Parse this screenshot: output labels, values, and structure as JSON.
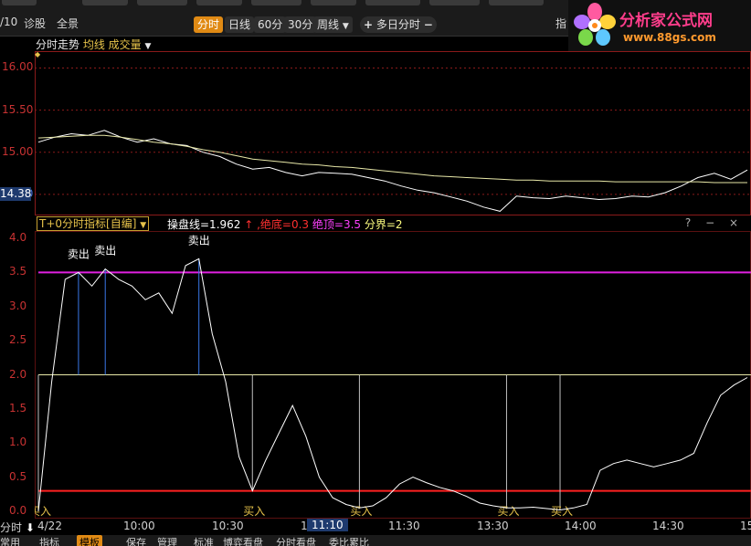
{
  "toolbar": {
    "date_fragment": "/10",
    "tab_diagnosis": "诊股",
    "tab_panorama": "全景",
    "periods": [
      "分时",
      "日线",
      "60分",
      "30分",
      "周线"
    ],
    "period_active": "分时",
    "multi_day": "多日分时",
    "indicator_btn": "指"
  },
  "logo": {
    "title": "分析家公式网",
    "url": "www.88gs.com"
  },
  "subtitle": {
    "label": "分时走势",
    "options": "均线 成交量"
  },
  "price_panel": {
    "yticks": [
      "16.00",
      "15.50",
      "15.00",
      "14.50"
    ],
    "current_price": "14.38",
    "colors": {
      "price_line": "#ffffff",
      "avg_line": "#e8e8a8",
      "grid": "#8a1a1a"
    }
  },
  "indicator": {
    "name": "T+0分时指标[自编]",
    "params": [
      {
        "text": "操盘线=1.962",
        "color": "#ffffff"
      },
      {
        "text": "↑",
        "color": "#ff3030"
      },
      {
        "text": ",绝底=0.3",
        "color": "#ff3030"
      },
      {
        "text": "绝顶=3.5",
        "color": "#ff40ff"
      },
      {
        "text": "分界=2",
        "color": "#ffff80"
      }
    ],
    "controls": "? − ×",
    "yticks": [
      "4.0",
      "3.5",
      "3.0",
      "2.5",
      "2.0",
      "1.5",
      "1.0",
      "0.5",
      "0.0"
    ],
    "top_line": 3.5,
    "mid_line": 2,
    "bottom_line": 0.3,
    "sell_label": "卖出",
    "buy_label": "买入",
    "colors": {
      "top_line": "#e020e0",
      "mid_line": "#e8e8a8",
      "bottom_line": "#ff2020",
      "signal_buy": "#c0c0c0",
      "signal_sell": "#3a78e8"
    }
  },
  "time_axis": {
    "mode": "分时",
    "labels": [
      "4/22",
      "10:00",
      "10:30",
      "1",
      "11:10",
      "11:30",
      "13:30",
      "14:00",
      "14:30",
      "15"
    ],
    "cursor_time": "11:10"
  },
  "bottom_tabs": [
    "常用",
    "指标",
    "模板",
    "保存",
    "管理",
    "标准",
    "博弈看盘",
    "分时看盘",
    "委比累比"
  ],
  "bottom_tab_active": "模板",
  "chart_data": [
    {
      "type": "line",
      "title": "分时走势",
      "xlabel": "",
      "ylabel": "",
      "ylim": [
        14.25,
        16.2
      ],
      "grid": true,
      "series": [
        {
          "name": "",
          "values": [
            15.12,
            15.18,
            15.22,
            15.2,
            15.26,
            15.18,
            15.12,
            15.16,
            15.1,
            15.08,
            15.0,
            14.95,
            14.86,
            14.8,
            14.82,
            14.76,
            14.72,
            14.76,
            14.75,
            14.74,
            14.7,
            14.66,
            14.6,
            14.55,
            14.52,
            14.47,
            14.42,
            14.35,
            14.3,
            14.48,
            14.46,
            14.45,
            14.48,
            14.46,
            14.44,
            14.45,
            14.48,
            14.47,
            14.52,
            14.6,
            14.7,
            14.75,
            14.68,
            14.79
          ]
        },
        {
          "name": "",
          "values": [
            15.17,
            15.18,
            15.19,
            15.2,
            15.2,
            15.18,
            15.15,
            15.12,
            15.1,
            15.07,
            15.03,
            15.0,
            14.96,
            14.92,
            14.9,
            14.88,
            14.86,
            14.85,
            14.83,
            14.82,
            14.8,
            14.78,
            14.76,
            14.74,
            14.72,
            14.71,
            14.7,
            14.69,
            14.68,
            14.67,
            14.67,
            14.66,
            14.66,
            14.66,
            14.66,
            14.65,
            14.65,
            14.65,
            14.65,
            14.65,
            14.65,
            14.64,
            14.64,
            14.64
          ]
        }
      ]
    },
    {
      "type": "line",
      "title": "T+0分时指标[自编]",
      "xlabel": "",
      "ylabel": "",
      "ylim": [
        0,
        4.0
      ],
      "series": [
        {
          "name": "操盘线",
          "values": [
            0.0,
            1.9,
            3.4,
            3.5,
            3.3,
            3.55,
            3.4,
            3.3,
            3.1,
            3.2,
            2.9,
            3.6,
            3.7,
            2.6,
            1.9,
            0.8,
            0.3,
            0.75,
            1.15,
            1.55,
            1.1,
            0.5,
            0.2,
            0.1,
            0.05,
            0.08,
            0.2,
            0.4,
            0.5,
            0.42,
            0.35,
            0.3,
            0.22,
            0.12,
            0.08,
            0.05,
            0.05,
            0.06,
            0.04,
            0.02,
            0.05,
            0.1,
            0.6,
            0.7,
            0.75,
            0.7,
            0.65,
            0.7,
            0.75,
            0.85,
            1.3,
            1.7,
            1.85,
            1.96
          ]
        }
      ]
    }
  ]
}
